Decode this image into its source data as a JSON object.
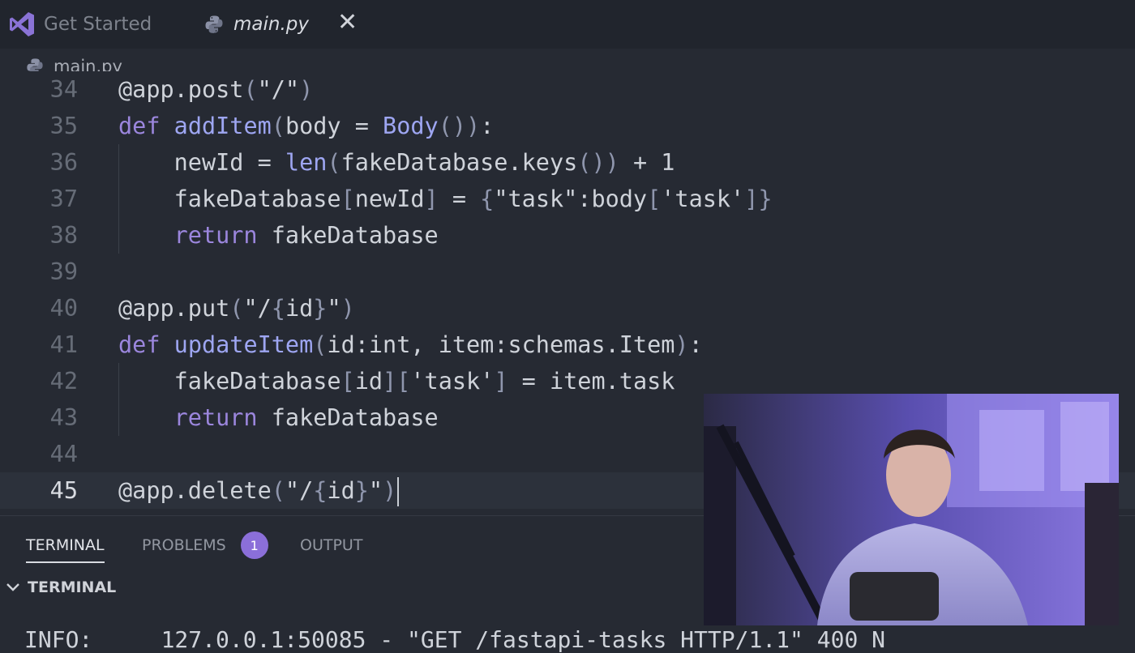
{
  "tabs": [
    {
      "label": "Get Started",
      "icon": "vscode-logo-icon",
      "active": false
    },
    {
      "label": "main.py",
      "icon": "python-icon",
      "active": true
    }
  ],
  "breadcrumb": {
    "file": "main.py",
    "icon": "python-icon"
  },
  "editor": {
    "current_line": 45,
    "lines": [
      {
        "n": "34",
        "text": "@app.post(\"/\")"
      },
      {
        "n": "35",
        "text": "def addItem(body = Body()):"
      },
      {
        "n": "36",
        "text": "    newId = len(fakeDatabase.keys()) + 1"
      },
      {
        "n": "37",
        "text": "    fakeDatabase[newId] = {\"task\":body['task']}"
      },
      {
        "n": "38",
        "text": "    return fakeDatabase"
      },
      {
        "n": "39",
        "text": ""
      },
      {
        "n": "40",
        "text": "@app.put(\"/{id}\")"
      },
      {
        "n": "41",
        "text": "def updateItem(id:int, item:schemas.Item):"
      },
      {
        "n": "42",
        "text": "    fakeDatabase[id]['task'] = item.task"
      },
      {
        "n": "43",
        "text": "    return fakeDatabase"
      },
      {
        "n": "44",
        "text": ""
      },
      {
        "n": "45",
        "text": "@app.delete(\"/{id}\")"
      }
    ]
  },
  "panel": {
    "tabs": [
      {
        "label": "TERMINAL",
        "active": true
      },
      {
        "label": "PROBLEMS",
        "badge": "1",
        "active": false
      },
      {
        "label": "OUTPUT",
        "active": false
      }
    ],
    "section_title": "TERMINAL",
    "terminal_partial": "INFO:     127.0.0.1:50085 - \"GET /fastapi-tasks HTTP/1.1\" 400 N"
  },
  "colors": {
    "editor_bg": "#262a33",
    "tabbar_bg": "#21252d",
    "keyword": "#9b86dd",
    "function": "#9ea6f2",
    "badge": "#8b6fd9"
  }
}
